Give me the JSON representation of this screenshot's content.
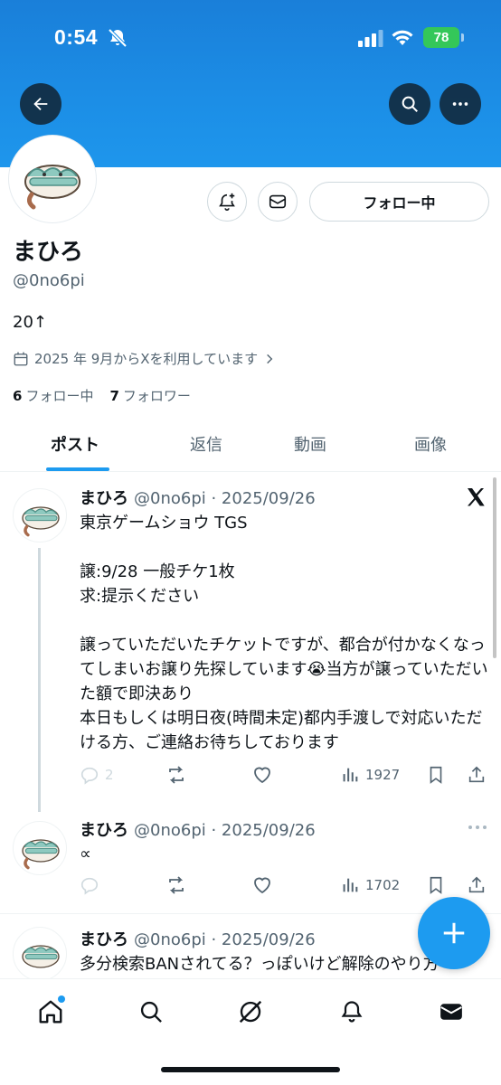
{
  "status_bar": {
    "time": "0:54",
    "battery": "78"
  },
  "profile": {
    "name": "まひろ",
    "handle": "@0no6pi",
    "bio": "20↑",
    "joined": "2025 年 9月からXを利用しています",
    "following_count": "6",
    "following_label": "フォロー中",
    "followers_count": "7",
    "followers_label": "フォロワー",
    "follow_button": "フォロー中"
  },
  "tabs": [
    "ポスト",
    "返信",
    "動画",
    "画像"
  ],
  "posts": [
    {
      "name": "まひろ",
      "meta": "@0no6pi · 2025/09/26",
      "text": "東京ゲームショウ TGS\n\n譲:9/28 一般チケ1枚\n求:提示ください\n\n譲っていただいたチケットですが、都合が付かなくなってしまいお譲り先探しています😭当方が譲っていただいた額で即決あり\n本日もしくは明日夜(時間未定)都内手渡しで対応いただける方、ご連絡お待ちしております",
      "replies": "2",
      "views": "1927"
    },
    {
      "name": "まひろ",
      "meta": "@0no6pi · 2025/09/26",
      "text": "∝",
      "replies": "",
      "views": "1702"
    },
    {
      "name": "まひろ",
      "meta": "@0no6pi · 2025/09/26",
      "text": "多分検索BANされてる？っぽいけど解除のやり方"
    }
  ],
  "colors": {
    "accent": "#1d9bf0",
    "banner": "#1c8ee6"
  }
}
